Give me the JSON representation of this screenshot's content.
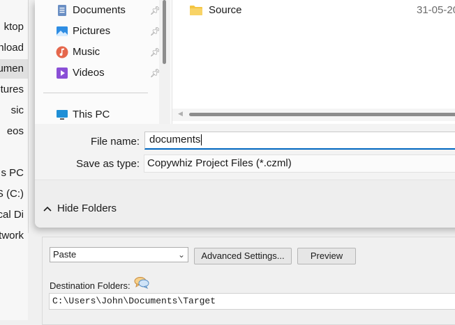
{
  "background_explorer": {
    "items": [
      "ktop",
      "wnload",
      "cumen",
      "tures",
      "sic",
      "eos",
      "s PC",
      "S (C:)",
      "ocal Di",
      "twork"
    ]
  },
  "dialog": {
    "nav_items": [
      {
        "label": "Documents",
        "icon": "documents-icon",
        "pinned": true
      },
      {
        "label": "Pictures",
        "icon": "pictures-icon",
        "pinned": true
      },
      {
        "label": "Music",
        "icon": "music-icon",
        "pinned": true
      },
      {
        "label": "Videos",
        "icon": "videos-icon",
        "pinned": true
      }
    ],
    "this_pc": "This PC",
    "files": [
      {
        "name": "Source",
        "date": "31-05-20"
      }
    ],
    "file_name_label": "File name:",
    "file_name_value": "documents",
    "save_type_label": "Save as type:",
    "save_type_value": "Copywhiz Project Files (*.czml)",
    "hide_folders": "Hide Folders"
  },
  "app": {
    "paste_option": "Paste",
    "advanced_button": "Advanced Settings...",
    "preview_button": "Preview",
    "destination_label": "Destination Folders:",
    "destination_path": "C:\\Users\\John\\Documents\\Target"
  },
  "colors": {
    "accent": "#0067c0",
    "folder": "#f4c542",
    "pin": "#8a8a8a"
  }
}
